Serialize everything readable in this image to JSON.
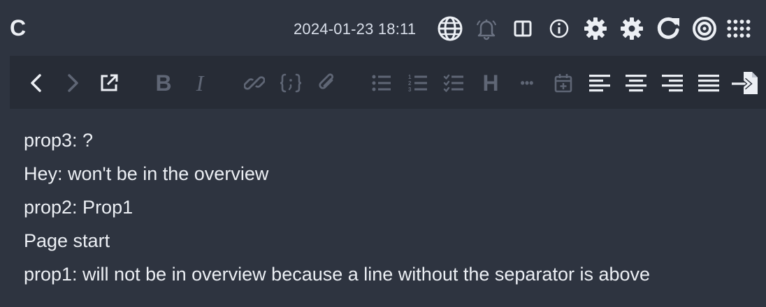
{
  "app": {
    "title": "C",
    "timestamp": "2024-01-23 18:11"
  },
  "topbar": {
    "icons": [
      "globe-icon",
      "bell-icon",
      "split-view-icon",
      "info-icon",
      "gear-icon",
      "gear-icon",
      "refresh-icon",
      "target-icon",
      "apps-grid-icon"
    ]
  },
  "toolbar": {
    "bold_label": "B",
    "italic_label": "I",
    "heading_label": "H",
    "more_label": "•••"
  },
  "content": {
    "lines": [
      "prop3: ?",
      "Hey: won't be in the overview",
      "prop2: Prop1",
      "Page start",
      "prop1: will not be in overview because a line without the separator is above"
    ]
  },
  "colors": {
    "background": "#2e3440",
    "toolbar": "#272c36",
    "icon_active": "#eceff4",
    "icon_dim": "#5f6675",
    "text": "#eceff4"
  }
}
